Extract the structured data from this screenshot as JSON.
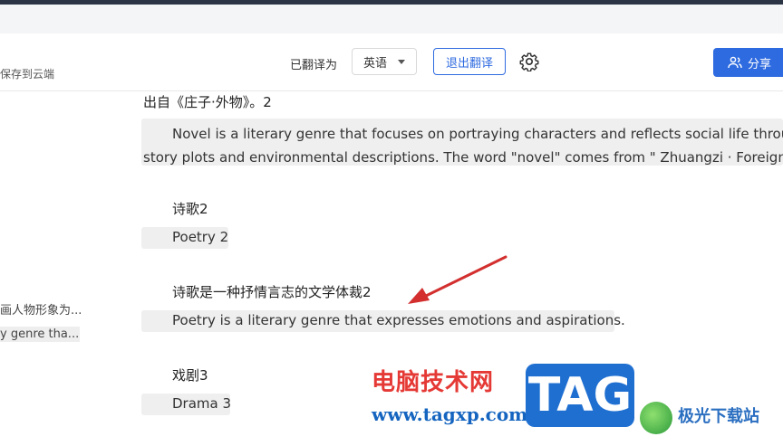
{
  "toolbar": {
    "save_hint": "保存到云端",
    "translated_label": "已翻译为",
    "language": "英语",
    "exit_label": "退出翻译",
    "share_label": "分享"
  },
  "sidebar": {
    "frag1": "画人物形象为...",
    "frag2": "y genre tha..."
  },
  "doc": {
    "line0_src": "出自《庄子·外物》。2",
    "line0_tr_1": "Novel is a literary genre that focuses on portraying characters and reflects social life through",
    "line0_tr_2": "story plots and environmental descriptions. The word \"novel\" comes from \" Zhuangzi · Foreign T",
    "h1_src": "诗歌2",
    "h1_tr": "Poetry 2",
    "p1_src": "诗歌是一种抒情言志的文学体裁2",
    "p1_tr": "Poetry is a literary genre that expresses emotions and aspirations.",
    "h2_src": "戏剧3",
    "h2_tr": "Drama 3"
  },
  "watermark": {
    "cn": "电脑技术网",
    "url": "www.tagxp.com",
    "tag": "TAG",
    "site2": "极光下载站"
  },
  "colors": {
    "accent": "#2f6be0",
    "annotation": "#d32f2f"
  }
}
